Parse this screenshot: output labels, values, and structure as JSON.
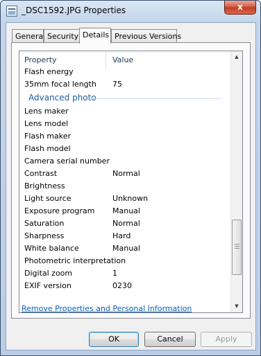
{
  "window": {
    "title": "_DSC1592.JPG Properties",
    "close_label": "x"
  },
  "tabs": [
    {
      "label": "General",
      "active": false
    },
    {
      "label": "Security",
      "active": false
    },
    {
      "label": "Details",
      "active": true
    },
    {
      "label": "Previous Versions",
      "active": false
    }
  ],
  "details": {
    "col_property": "Property",
    "col_value": "Value",
    "rows_top": [
      {
        "property": "Flash energy",
        "value": ""
      },
      {
        "property": "35mm focal length",
        "value": "75"
      }
    ],
    "group_label": "Advanced photo",
    "rows": [
      {
        "property": "Lens maker",
        "value": ""
      },
      {
        "property": "Lens model",
        "value": ""
      },
      {
        "property": "Flash maker",
        "value": ""
      },
      {
        "property": "Flash model",
        "value": ""
      },
      {
        "property": "Camera serial number",
        "value": ""
      },
      {
        "property": "Contrast",
        "value": "Normal"
      },
      {
        "property": "Brightness",
        "value": ""
      },
      {
        "property": "Light source",
        "value": "Unknown"
      },
      {
        "property": "Exposure program",
        "value": "Manual"
      },
      {
        "property": "Saturation",
        "value": "Normal"
      },
      {
        "property": "Sharpness",
        "value": "Hard"
      },
      {
        "property": "White balance",
        "value": "Manual"
      },
      {
        "property": "Photometric interpretation",
        "value": ""
      },
      {
        "property": "Digital zoom",
        "value": "1"
      },
      {
        "property": "EXIF version",
        "value": "0230"
      }
    ]
  },
  "remove_link": "Remove Properties and Personal Information",
  "buttons": {
    "ok": "OK",
    "cancel": "Cancel",
    "apply": "Apply"
  }
}
